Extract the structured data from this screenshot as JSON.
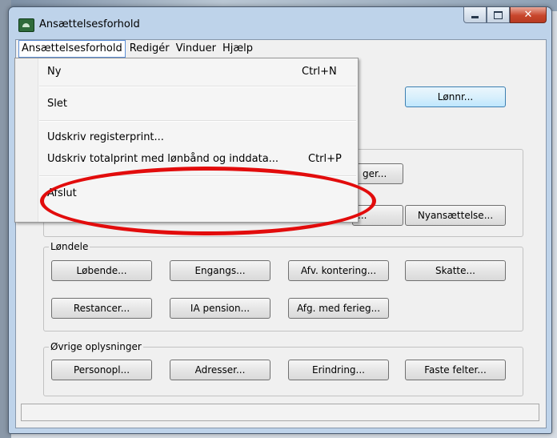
{
  "window": {
    "title": "Ansættelsesforhold"
  },
  "menubar": {
    "items": [
      "Ansættelsesforhold",
      "Redigér",
      "Vinduer",
      "Hjælp"
    ]
  },
  "dropdown": {
    "items": [
      {
        "label": "Ny",
        "shortcut": "Ctrl+N"
      },
      {
        "label": "Slet",
        "shortcut": ""
      },
      {
        "label": "Udskriv registerprint...",
        "shortcut": ""
      },
      {
        "label": "Udskriv totalprint med lønbånd og inddata...",
        "shortcut": "Ctrl+P"
      },
      {
        "label": "Afslut",
        "shortcut": ""
      }
    ]
  },
  "top": {
    "lonnr_label": "Lønnr...",
    "partial1": "ger...",
    "partial2": "...",
    "nyansaettelse_label": "Nyansættelse..."
  },
  "londele": {
    "title": "Løndele",
    "buttons": [
      "Løbende...",
      "Engangs...",
      "Afv. kontering...",
      "Skatte...",
      "Restancer...",
      "IA pension...",
      "Afg. med ferieg..."
    ]
  },
  "ovrige": {
    "title": "Øvrige oplysninger",
    "buttons": [
      "Personopl...",
      "Adresser...",
      "Erindring...",
      "Faste felter..."
    ]
  },
  "colors": {
    "annotation": "#e20c0c",
    "focus": "#3c7fb1"
  }
}
